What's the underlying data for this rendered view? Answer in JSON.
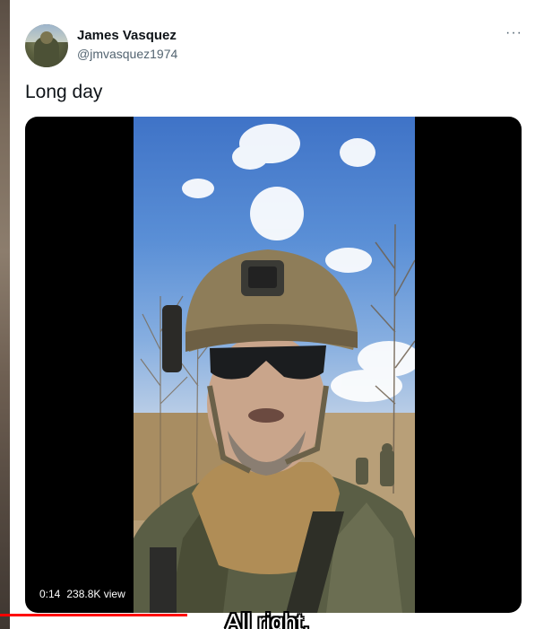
{
  "tweet": {
    "author_name": "James Vasquez",
    "author_handle": "@jmvasquez1974",
    "text": "Long day",
    "more_icon": "more-horizontal-icon"
  },
  "video": {
    "elapsed": "0:14",
    "views": "238.8K view",
    "progress_fraction": 0.35,
    "subtitle": "All right."
  },
  "colors": {
    "progress": "#ff0000",
    "handle": "#536471",
    "text": "#0f1419"
  }
}
